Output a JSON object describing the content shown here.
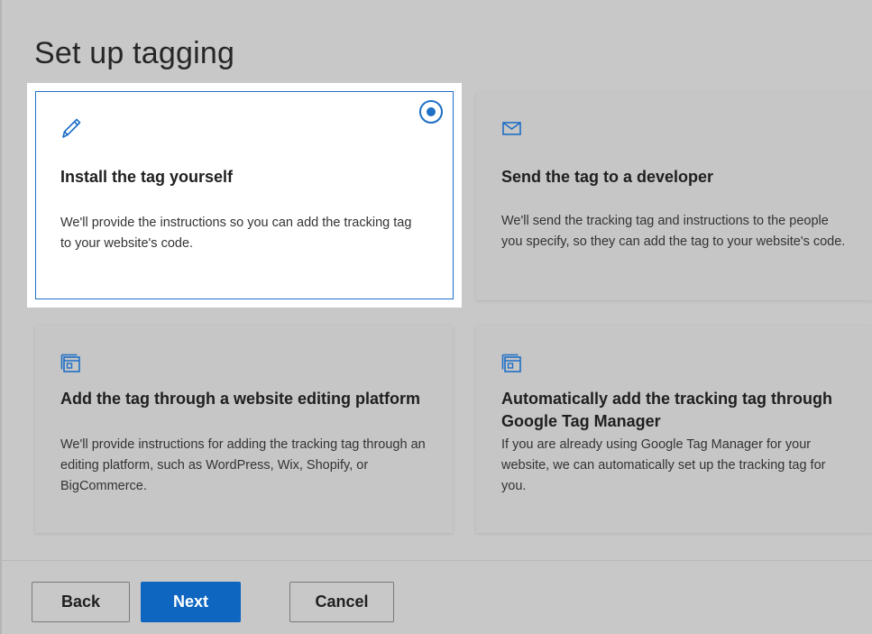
{
  "page": {
    "title": "Set up tagging"
  },
  "options": [
    {
      "title": "Install the tag yourself",
      "description": "We'll provide the instructions so you can add the tracking tag to your website's code.",
      "icon": "pencil-icon",
      "selected": true
    },
    {
      "title": "Send the tag to a developer",
      "description": "We'll send the tracking tag and instructions to the people you specify, so they can add the tag to your website's code.",
      "icon": "envelope-icon",
      "selected": false
    },
    {
      "title": "Add the tag through a website editing platform",
      "description": "We'll provide instructions for adding the tracking tag through an editing platform, such as WordPress, Wix, Shopify, or BigCommerce.",
      "icon": "browser-window-icon",
      "selected": false
    },
    {
      "title": "Automatically add the tracking tag through Google Tag Manager",
      "description": "If you are already using Google Tag Manager for your website, we can automatically set up the tracking tag for you.",
      "icon": "browser-window-icon",
      "selected": false
    }
  ],
  "footer": {
    "back_label": "Back",
    "next_label": "Next",
    "cancel_label": "Cancel"
  },
  "colors": {
    "accent": "#0f66c0",
    "overlay_background": "#c8c8c8",
    "selected_card_background": "#ffffff"
  }
}
